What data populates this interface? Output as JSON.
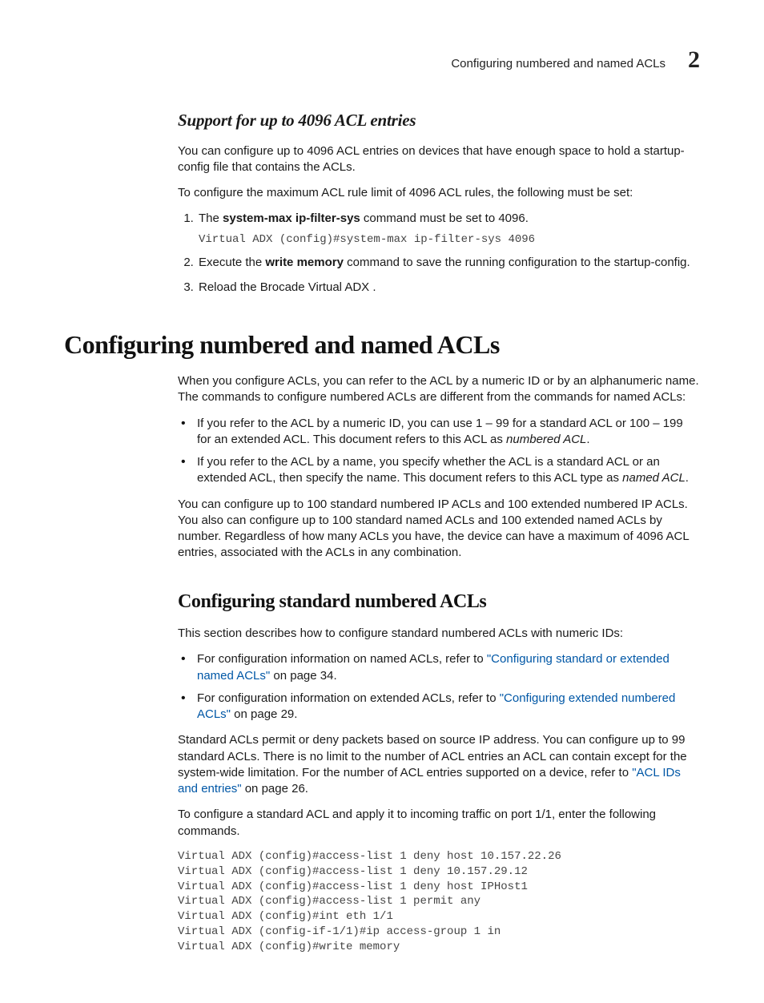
{
  "header": {
    "running_title": "Configuring numbered and named ACLs",
    "chapter_number": "2"
  },
  "s1": {
    "heading": "Support for up to 4096 ACL entries",
    "p1": "You can configure up to 4096 ACL entries on devices that have enough space to hold a startup-config file that contains the ACLs.",
    "p2": "To configure the maximum ACL rule limit of 4096 ACL rules, the following must be set:",
    "li1a": "The ",
    "li1b": "system-max ip-filter-sys",
    "li1c": " command must be set to 4096.",
    "code1": "Virtual ADX (config)#system-max ip-filter-sys 4096",
    "li2a": "Execute the ",
    "li2b": "write memory",
    "li2c": " command to save the running configuration to the startup-config.",
    "li3": "Reload the Brocade Virtual ADX ."
  },
  "s2": {
    "title": "Configuring numbered and named ACLs",
    "p1": "When you configure ACLs, you can refer to the ACL by a numeric ID or by an alphanumeric name. The commands to configure numbered ACLs are different from the commands for named ACLs:",
    "b1a": "If you refer to the ACL by a numeric ID, you can use 1 – 99 for a standard ACL or 100 – 199 for an extended ACL. This document refers to this ACL as ",
    "b1i": "numbered ACL",
    "b1b": ".",
    "b2a": "If you refer to the ACL by a name, you specify whether the ACL is a standard ACL or an extended ACL, then specify the name. This document refers to this ACL type as ",
    "b2i": "named ACL",
    "b2b": ".",
    "p2": "You can configure up to 100 standard numbered IP ACLs and 100 extended numbered IP ACLs. You also can configure up to 100 standard named ACLs and 100 extended named ACLs by number. Regardless of how many ACLs you have, the device can have a maximum of 4096 ACL entries, associated with the ACLs in any combination."
  },
  "s3": {
    "heading": "Configuring standard numbered ACLs",
    "p1": "This section describes how to configure standard numbered ACLs with numeric IDs:",
    "b1a": "For configuration information on named ACLs, refer to ",
    "b1link": "\"Configuring standard or extended named ACLs\"",
    "b1b": " on page 34.",
    "b2a": "For configuration information on extended ACLs, refer to ",
    "b2link": "\"Configuring extended numbered ACLs\"",
    "b2b": " on page 29.",
    "p2a": "Standard ACLs permit or deny packets based on source IP address. You can configure up to 99 standard ACLs. There is no limit to the number of ACL entries an ACL can contain except for the system-wide limitation. For the number of ACL entries supported on a device, refer to ",
    "p2link": "\"ACL IDs and entries\"",
    "p2b": " on page 26.",
    "p3": "To configure a standard ACL and apply it to incoming traffic on port 1/1, enter the following commands.",
    "code": "Virtual ADX (config)#access-list 1 deny host 10.157.22.26\nVirtual ADX (config)#access-list 1 deny 10.157.29.12\nVirtual ADX (config)#access-list 1 deny host IPHost1\nVirtual ADX (config)#access-list 1 permit any\nVirtual ADX (config)#int eth 1/1\nVirtual ADX (config-if-1/1)#ip access-group 1 in\nVirtual ADX (config)#write memory"
  }
}
